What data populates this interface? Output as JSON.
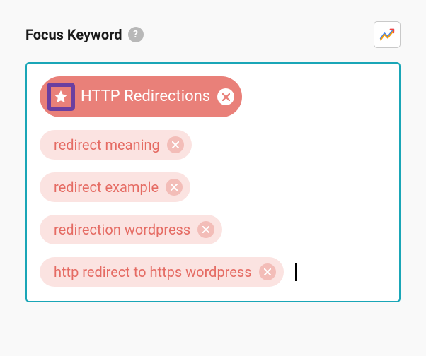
{
  "header": {
    "title": "Focus Keyword",
    "help_glyph": "?"
  },
  "keywords": {
    "primary": {
      "label": "HTTP Redirections"
    },
    "secondary": [
      {
        "label": "redirect meaning"
      },
      {
        "label": "redirect example"
      },
      {
        "label": "redirection wordpress"
      },
      {
        "label": "http redirect to https wordpress"
      }
    ]
  },
  "colors": {
    "box_border": "#1aa6b7",
    "primary_tag_bg": "#e98079",
    "secondary_tag_bg": "#fbe3e1",
    "secondary_tag_text": "#e56b63",
    "highlight_border": "#6b3fa0"
  },
  "icons": {
    "star": "star-icon",
    "help": "help-icon",
    "trends": "trends-icon",
    "remove": "close-icon"
  }
}
